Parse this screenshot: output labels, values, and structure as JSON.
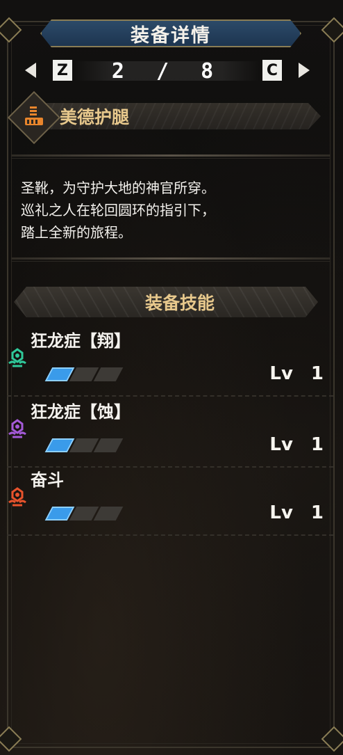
{
  "title": "装备详情",
  "pager": {
    "left_key": "Z",
    "right_key": "C",
    "position": "2 / 8"
  },
  "item": {
    "name": "美德护腿",
    "icon": "leg-armor-icon",
    "icon_color": "#e8852c"
  },
  "description": [
    "圣靴，为守护大地的神官所穿。",
    "巡礼之人在轮回圆环的指引下，",
    "踏上全新的旅程。"
  ],
  "skills_header": "装备技能",
  "skills": [
    {
      "name": "狂龙症【翔】",
      "level_label": "Lv",
      "level": "1",
      "pips_filled": 1,
      "pips_total": 3,
      "icon": "skill-jewel-icon",
      "icon_color": "#2fc99a"
    },
    {
      "name": "狂龙症【蚀】",
      "level_label": "Lv",
      "level": "1",
      "pips_filled": 1,
      "pips_total": 3,
      "icon": "skill-jewel-icon",
      "icon_color": "#a45ad8"
    },
    {
      "name": "奋斗",
      "level_label": "Lv",
      "level": "1",
      "pips_filled": 1,
      "pips_total": 3,
      "icon": "skill-jewel-icon",
      "icon_color": "#e8532c"
    }
  ]
}
